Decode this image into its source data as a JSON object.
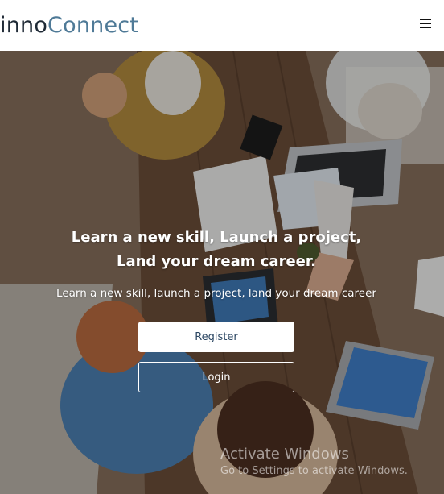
{
  "navbar": {
    "brand_part1": "inno",
    "brand_part2": "Connect",
    "menu_icon": "hamburger-menu-icon"
  },
  "hero": {
    "headline_line1": "Learn a new skill, Launch a project,",
    "headline_line2": "Land your dream career.",
    "subheadline": "Learn a new skill, launch a project, land your dream career",
    "register_label": "Register",
    "login_label": "Login"
  },
  "watermark": {
    "title": "Activate Windows",
    "subtitle": "Go to Settings to activate Windows."
  },
  "colors": {
    "brand_dark": "#1f2a36",
    "brand_accent": "#4f7a97",
    "button_text": "#2c4763"
  }
}
